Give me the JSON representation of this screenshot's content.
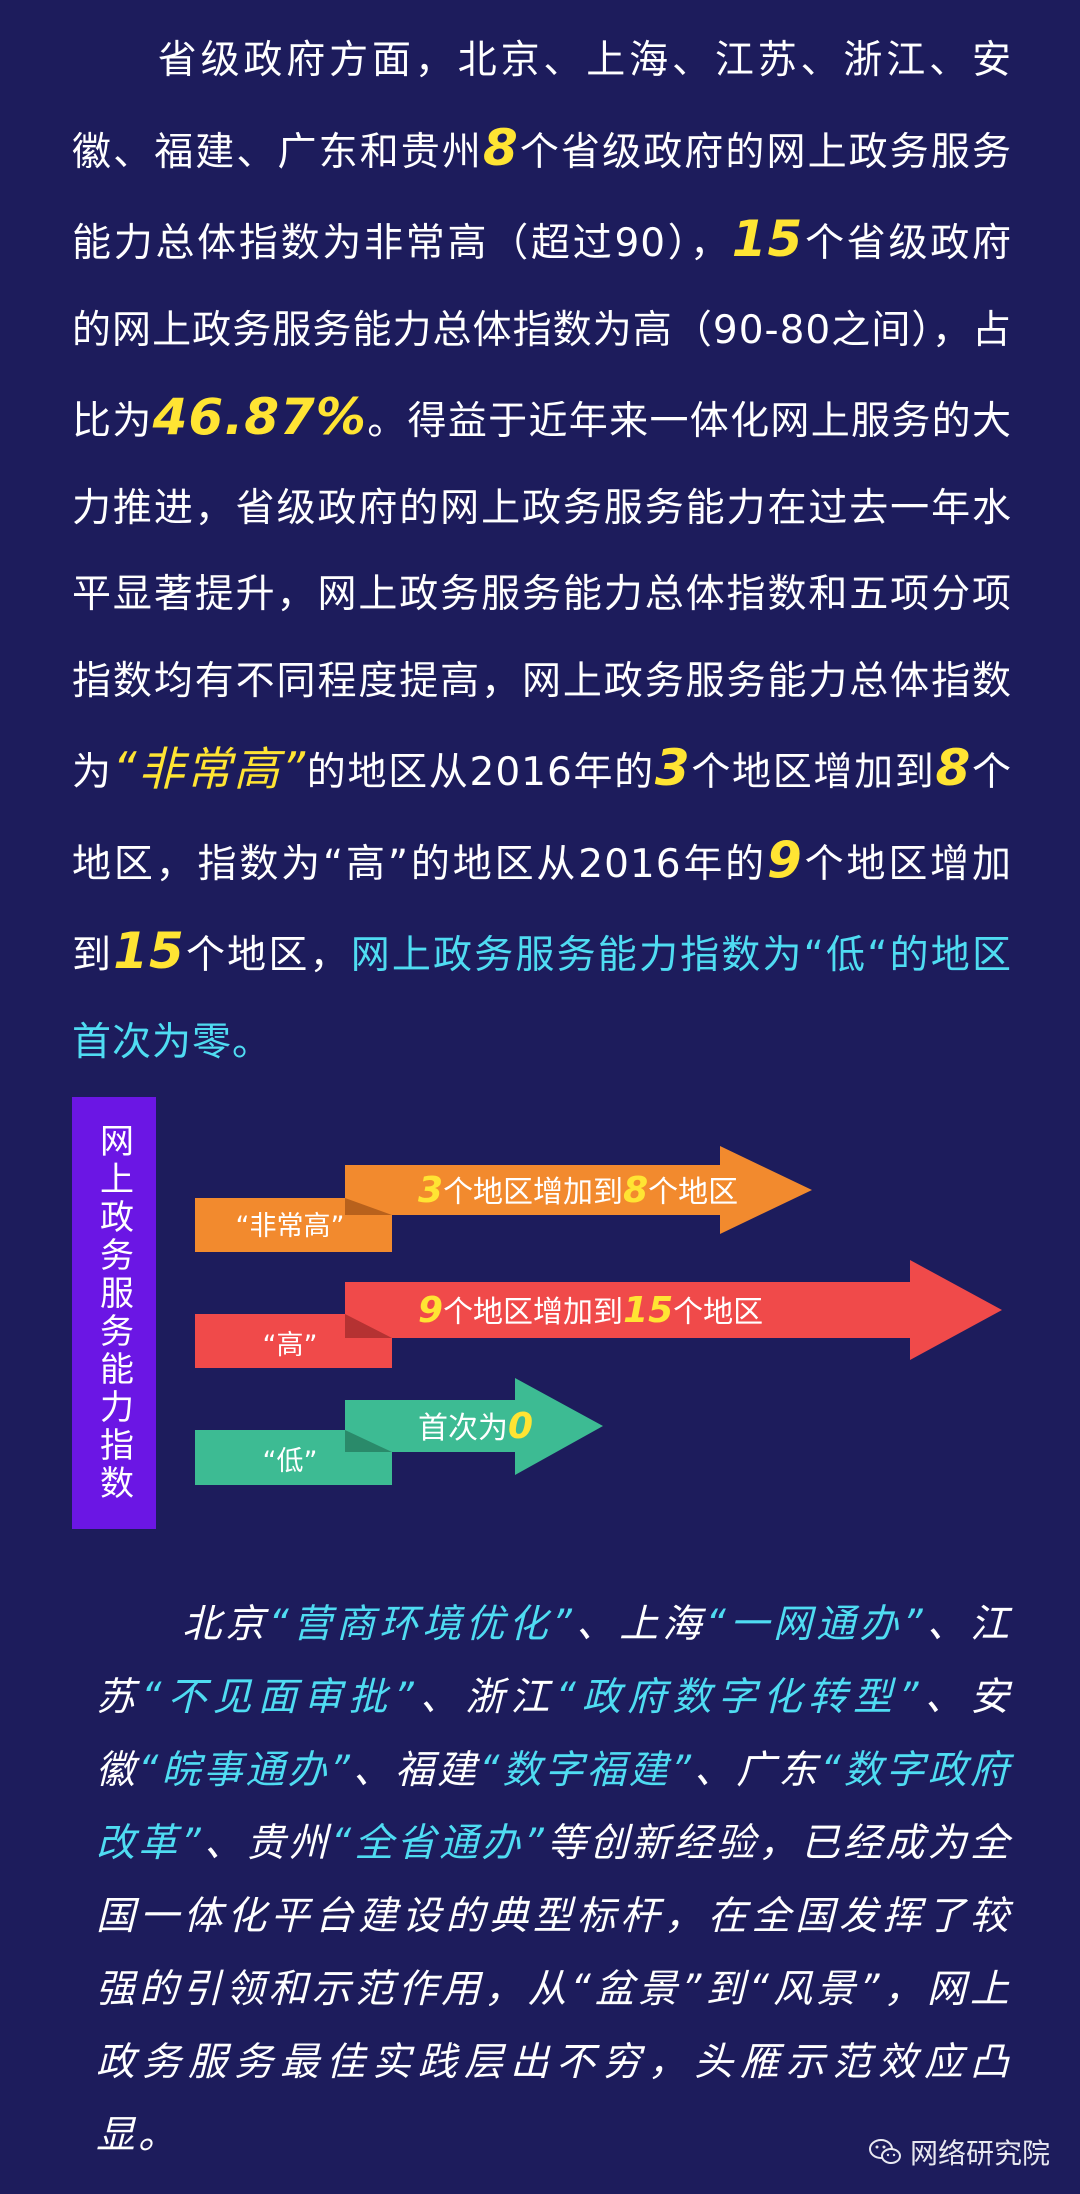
{
  "p1": {
    "a": "　　省级政府方面，北京、上海、江苏、浙江、安徽、福建、广东和贵州",
    "n1": "8",
    "b": "个省级政府的网上政务服务能力总体指数为非常高（超过90），",
    "n2": "15",
    "c": "个省级政府的网上政务服务能力总体指数为高（90-80之间），占比为",
    "pct": "46.87%",
    "d": "。得益于近年来一体化网上服务的大力推进，省级政府的网上政务服务能力在过去一年水平显著提升，网上政务服务能力总体指数和五项分项指数均有不同程度提高，网上政务服务能力总体指数为",
    "vh": "“非常高”",
    "e": "的地区从2016年的",
    "n3": "3",
    "f": "个地区增加到",
    "n4": "8",
    "g": "个地区，指数为“高”的地区从2016年的",
    "n5": "9",
    "h": "个地区增加到",
    "n6": "15",
    "i": "个地区，",
    "j": "网上政务服务能力指数为“低“的地区首次为零。"
  },
  "diagram": {
    "side_label": "网上政务服务能力指数",
    "rows": [
      {
        "label": "“非常高”",
        "n1": "3",
        "mid": "个地区增加到",
        "n2": "8",
        "tail": "个地区",
        "color": "#f28a2e"
      },
      {
        "label": "“高”",
        "n1": "9",
        "mid": "个地区增加到",
        "n2": "15",
        "tail": "个地区",
        "color": "#f04a4a"
      },
      {
        "label": "“低”",
        "pre": "首次为",
        "n1": "0",
        "color": "#3dbb93"
      }
    ]
  },
  "p2": {
    "a": "　　北京",
    "q1": "“营商环境优化”",
    "b": "、上海",
    "q2": "“一网通办”",
    "c": "、江苏",
    "q3": "“不见面审批”",
    "d": "、浙江",
    "q4": "“政府数字化转型”",
    "e": "、安徽",
    "q5": "“皖事通办”",
    "f": "、福建",
    "q6": "“数字福建”",
    "g": "、广东",
    "q7": "“数字政府改革”",
    "h": "、贵州",
    "q8": "“全省通办”",
    "i": "等创新经验，已经成为全国一体化平台建设的典型标杆，在全国发挥了较强的引领和示范作用，从“盆景”到“风景”，网上政务服务最佳实践层出不穷，头雁示范效应凸显。"
  },
  "footer": {
    "brand": "网络研究院",
    "icon": "wechat-icon"
  }
}
